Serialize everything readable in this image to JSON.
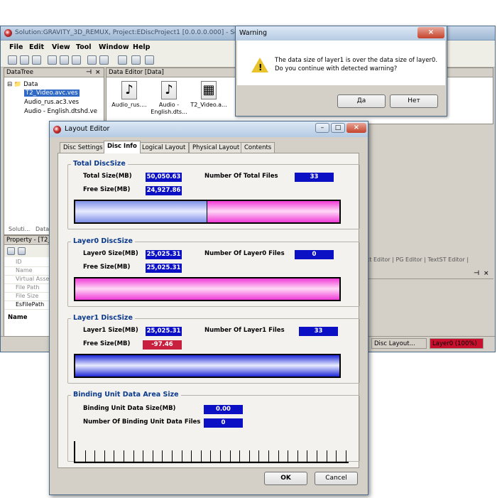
{
  "main_window": {
    "title": "Solution:GRAVITY_3D_REMUX, Project:EDiscProject1 [0.0.0.0.000] - Scenarist",
    "menu": [
      "File",
      "Edit",
      "View",
      "Tool",
      "Window",
      "Help"
    ],
    "toolbar_icons": [
      "new-icon",
      "open-icon",
      "save-icon",
      "cut-icon",
      "copy-icon",
      "paste-icon",
      "undo-icon",
      "redo-icon",
      "build-icon",
      "network-icon",
      "settings-icon"
    ],
    "datatree": {
      "header": "DataTree",
      "items": [
        {
          "label": "Data",
          "level": 0
        },
        {
          "label": "T2_Video.avc.ves",
          "level": 1,
          "selected": true
        },
        {
          "label": "Audio_rus.ac3.ves",
          "level": 1
        },
        {
          "label": "Audio - English.dtshd.ve",
          "level": 1
        }
      ],
      "bottom_tabs": [
        "Soluti...",
        "Data..."
      ]
    },
    "data_editor": {
      "header": "Data Editor [Data]",
      "files": [
        {
          "label": "Audio_rus....",
          "icon": "music-note-icon"
        },
        {
          "label": "Audio - English.dts...",
          "icon": "music-note-icon"
        },
        {
          "label": "T2_Video.a...",
          "icon": "film-icon"
        }
      ]
    },
    "property": {
      "header": "Property - [T2_...",
      "rows": [
        "ID",
        "Name",
        "Virtual Asse...",
        "File Path",
        "File Size",
        "EsFilePath"
      ],
      "desc_title": "Name"
    },
    "right_tabs": "ect Editor | PG Editor | TextST Editor |",
    "status": {
      "disc_layout": "Disc Layout...",
      "layer0": "Layer0 (100%)"
    }
  },
  "warning_dialog": {
    "title": "Warning",
    "message_line1": "The data size of layer1 is over the data size of layer0.",
    "message_line2": "Do you continue with detected warning?",
    "yes_label": "Да",
    "no_label": "Нет"
  },
  "layout_editor": {
    "title": "Layout Editor",
    "tabs": [
      "Disc Settings",
      "Disc Info",
      "Logical Layout",
      "Physical Layout",
      "Contents"
    ],
    "active_tab": "Disc Info",
    "total": {
      "title": "Total DiscSize",
      "total_size_label": "Total Size(MB)",
      "total_size": "50,050.63",
      "num_files_label": "Number Of Total Files",
      "num_files": "33",
      "free_size_label": "Free Size(MB)",
      "free_size": "24,927.86",
      "used_fraction": 0.5
    },
    "layer0": {
      "title": "Layer0 DiscSize",
      "size_label": "Layer0 Size(MB)",
      "size": "25,025.31",
      "num_files_label": "Number Of Layer0 Files",
      "num_files": "0",
      "free_size_label": "Free Size(MB)",
      "free_size": "25,025.31"
    },
    "layer1": {
      "title": "Layer1 DiscSize",
      "size_label": "Layer1 Size(MB)",
      "size": "25,025.31",
      "num_files_label": "Number Of Layer1 Files",
      "num_files": "33",
      "free_size_label": "Free Size(MB)",
      "free_size": "-97.46"
    },
    "binding": {
      "title": "Binding Unit Data Area Size",
      "size_label": "Binding Unit Data Size(MB)",
      "size": "0.00",
      "num_files_label": "Number Of Binding Unit Data Files",
      "num_files": "0"
    },
    "ok_label": "OK",
    "cancel_label": "Cancel"
  },
  "colors": {
    "value_box": "#0b10c4",
    "negative_value": "#c9203f",
    "group_title": "#0b3a8c",
    "used_space": "#7f90e8",
    "free_space": "#f03ad6"
  }
}
